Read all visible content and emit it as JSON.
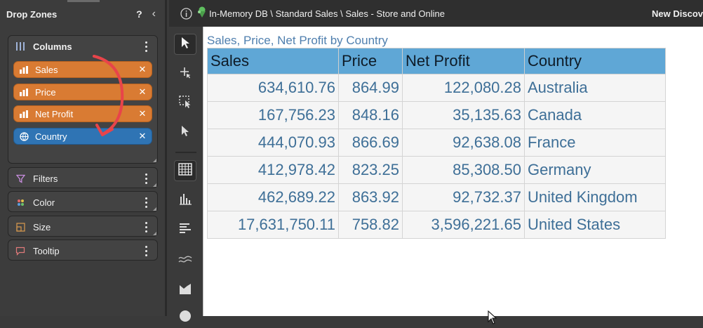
{
  "drop_zones": {
    "title": "Drop Zones",
    "help": "?",
    "columns": {
      "label": "Columns",
      "items": [
        {
          "label": "Sales",
          "color": "#d97b33"
        },
        {
          "label": "Price",
          "color": "#d97b33"
        },
        {
          "label": "Net Profit",
          "color": "#d97b33"
        },
        {
          "label": "Country",
          "color": "#2f74b4"
        }
      ]
    },
    "filters": {
      "label": "Filters"
    },
    "color": {
      "label": "Color"
    },
    "size": {
      "label": "Size"
    },
    "tooltip": {
      "label": "Tooltip"
    }
  },
  "header": {
    "breadcrumb": "In-Memory DB \\ Standard Sales \\ Sales - Store and Online",
    "new_discovery": "New Discov"
  },
  "viz": {
    "title": "Sales, Price, Net Profit by Country",
    "columns": [
      "Sales",
      "Price",
      "Net Profit",
      "Country"
    ],
    "rows": [
      [
        "634,610.76",
        "864.99",
        "122,080.28",
        "Australia"
      ],
      [
        "167,756.23",
        "848.16",
        "35,135.63",
        "Canada"
      ],
      [
        "444,070.93",
        "866.69",
        "92,638.08",
        "France"
      ],
      [
        "412,978.42",
        "823.25",
        "85,308.50",
        "Germany"
      ],
      [
        "462,689.22",
        "863.92",
        "92,732.37",
        "United Kingdom"
      ],
      [
        "17,631,750.11",
        "758.82",
        "3,596,221.65",
        "United States"
      ]
    ]
  },
  "icons": {
    "toolbar": [
      "select-arrow-icon",
      "move-crosshair-icon",
      "marquee-select-icon",
      "pointer-select-icon",
      "grid-chart-icon",
      "bar-chart-icon",
      "horizontal-bar-icon",
      "line-chart-icon",
      "area-chart-icon",
      "pie-chart-icon"
    ]
  },
  "colors": {
    "accent_orange": "#d97b33",
    "accent_blue": "#2f74b4",
    "table_header": "#5fa7d6",
    "table_text": "#3e6f97"
  }
}
